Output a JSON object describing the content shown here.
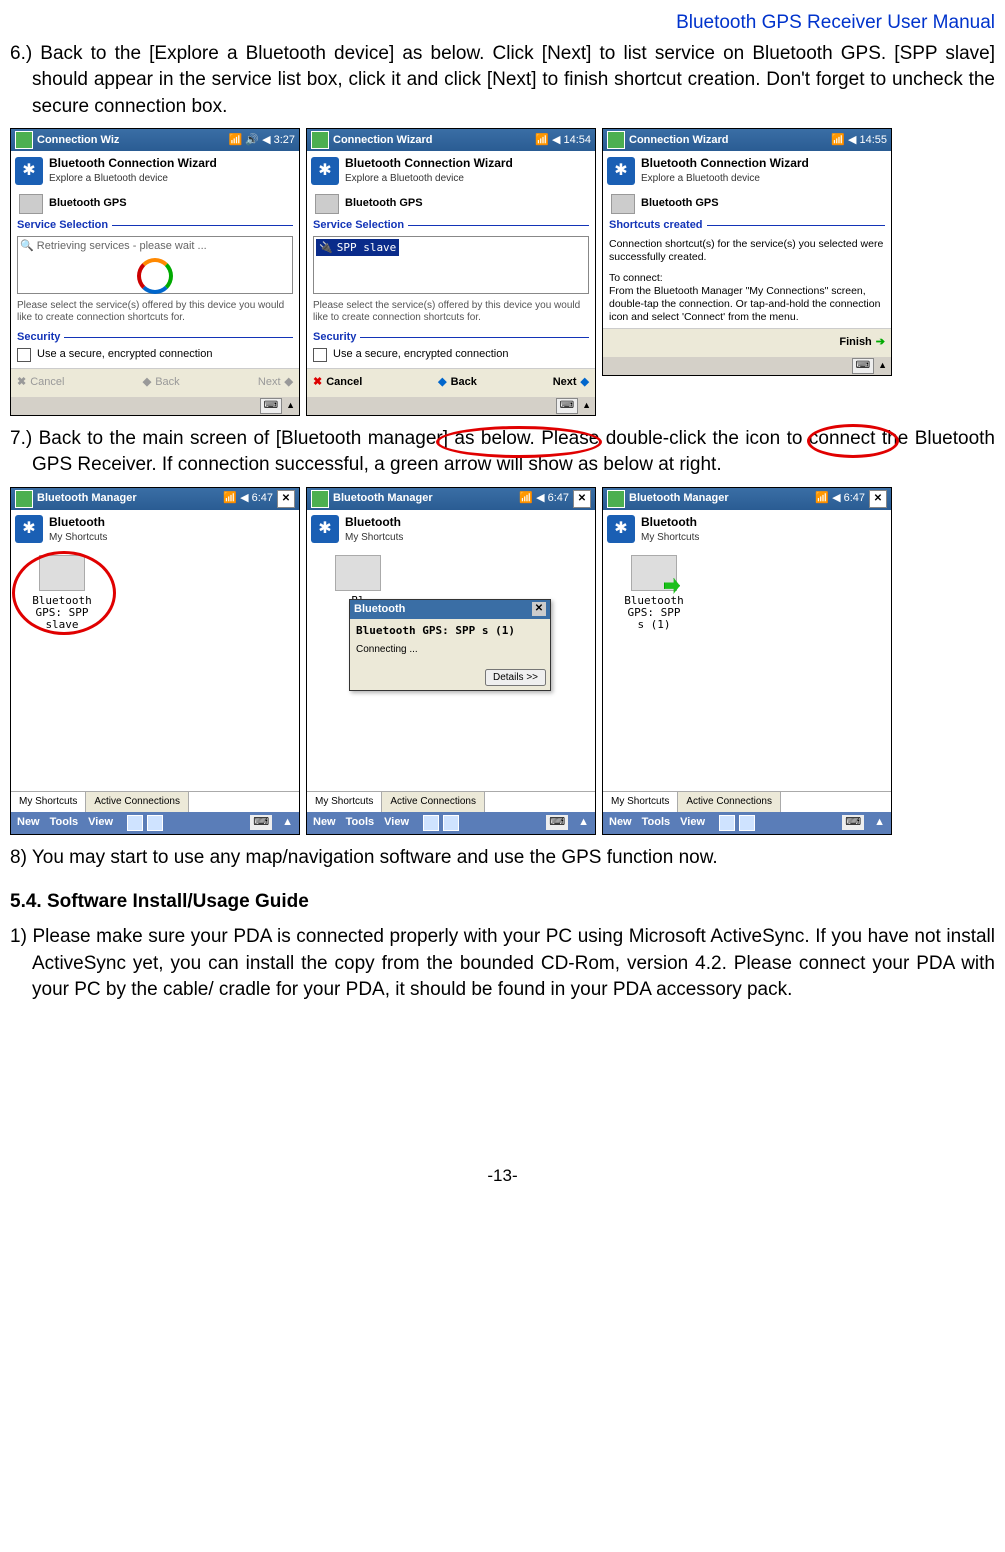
{
  "header": "Bluetooth GPS Receiver User Manual",
  "step6": "6.) Back to the [Explore a Bluetooth device] as below. Click [Next] to list service on Bluetooth GPS. [SPP slave] should appear in the service list box, click it and click [Next] to finish shortcut creation. Don't forget to uncheck the secure connection box.",
  "step7": "7.) Back to the main screen of [Bluetooth manager] as below. Please double-click the icon to connect the Bluetooth GPS Receiver. If connection successful, a green arrow will show as below at right.",
  "step8": "8) You may start to use any map/navigation software and use the GPS function now.",
  "section54": "5.4. Software Install/Usage Guide",
  "step54_1": "1) Please make sure your PDA is connected properly with your PC using Microsoft ActiveSync. If you have not install ActiveSync yet, you can install the copy from the bounded CD-Rom, version 4.2. Please connect your PDA with your PC by the cable/ cradle for your PDA, it should be found in your PDA accessory pack.",
  "footer": "-13-",
  "wiz": {
    "title1": "Connection Wiz",
    "title23": "Connection Wizard",
    "time1": "3:27",
    "time2": "14:54",
    "time3": "14:55",
    "heading": "Bluetooth Connection Wizard",
    "subtitle": "Explore a Bluetooth device",
    "device": "Bluetooth GPS",
    "svc_section": "Service Selection",
    "retrieving": "Retrieving services - please wait ...",
    "spp": "SPP slave",
    "helper": "Please select the service(s) offered by this device you would like to create connection shortcuts for.",
    "sec_section": "Security",
    "chk_label": "Use a secure, encrypted connection",
    "sc_section": "Shortcuts created",
    "sc_body1": "Connection shortcut(s) for the service(s) you selected were successfully created.",
    "sc_body2": "To connect:\nFrom the Bluetooth Manager \"My Connections\" screen, double-tap the connection. Or tap-and-hold the connection icon and select 'Connect' from the menu.",
    "cancel": "Cancel",
    "back": "Back",
    "next": "Next",
    "finish": "Finish"
  },
  "mgr": {
    "title": "Bluetooth Manager",
    "time": "6:47",
    "heading": "Bluetooth",
    "sub": "My Shortcuts",
    "sc_label_a": "Bluetooth\nGPS: SPP\nslave",
    "sc_label_c": "Bluetooth\nGPS: SPP\ns (1)",
    "tab1": "My Shortcuts",
    "tab2": "Active Connections",
    "menu_new": "New",
    "menu_tools": "Tools",
    "menu_view": "View",
    "popup_title": "Bluetooth",
    "popup_msg": "Bluetooth GPS: SPP s (1)",
    "popup_conn": "Connecting ...",
    "popup_btn": "Details >>"
  }
}
